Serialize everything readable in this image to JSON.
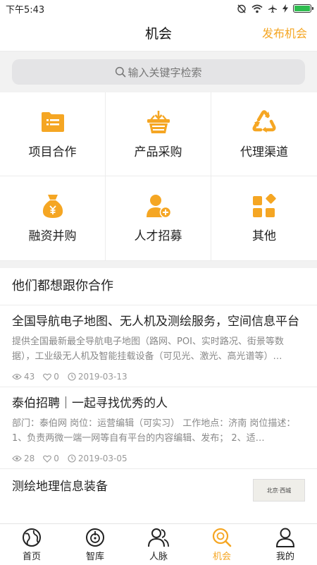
{
  "status": {
    "time": "下午5:43"
  },
  "header": {
    "title": "机会",
    "publish_label": "发布机会"
  },
  "search": {
    "placeholder": "输入关键字检索"
  },
  "categories": [
    {
      "label": "项目合作",
      "icon": "folder-list-icon"
    },
    {
      "label": "产品采购",
      "icon": "shopping-basket-icon"
    },
    {
      "label": "代理渠道",
      "icon": "recycle-arrows-icon"
    },
    {
      "label": "融资并购",
      "icon": "money-bag-icon"
    },
    {
      "label": "人才招募",
      "icon": "add-person-icon"
    },
    {
      "label": "其他",
      "icon": "grid-diamond-icon"
    }
  ],
  "feed": {
    "heading": "他们都想跟你合作",
    "items": [
      {
        "title": "全国导航电子地图、无人机及测绘服务，空间信息平台",
        "desc": "提供全国最新最全导航电子地图（路网、POI、实时路况、街景等数据），工业级无人机及智能挂载设备（可见光、激光、高光谱等）…",
        "views": "43",
        "likes": "0",
        "date": "2019-03-13"
      },
      {
        "title": "泰伯招聘｜一起寻找优秀的人",
        "desc": "部门：泰伯网 岗位：运营编辑（可实习） 工作地点：济南 岗位描述： 1、负责两微一端一网等自有平台的内容编辑、发布； 2、适…",
        "views": "28",
        "likes": "0",
        "date": "2019-03-05"
      },
      {
        "title": "测绘地理信息装备",
        "thumb_text": "北京·西城"
      }
    ]
  },
  "tabs": [
    {
      "label": "首页",
      "icon": "home-globe-icon"
    },
    {
      "label": "智库",
      "icon": "think-tank-icon"
    },
    {
      "label": "人脉",
      "icon": "contacts-icon"
    },
    {
      "label": "机会",
      "icon": "opportunity-search-icon"
    },
    {
      "label": "我的",
      "icon": "profile-icon"
    }
  ],
  "colors": {
    "accent": "#f5a623",
    "battery": "#2ebd4f"
  }
}
